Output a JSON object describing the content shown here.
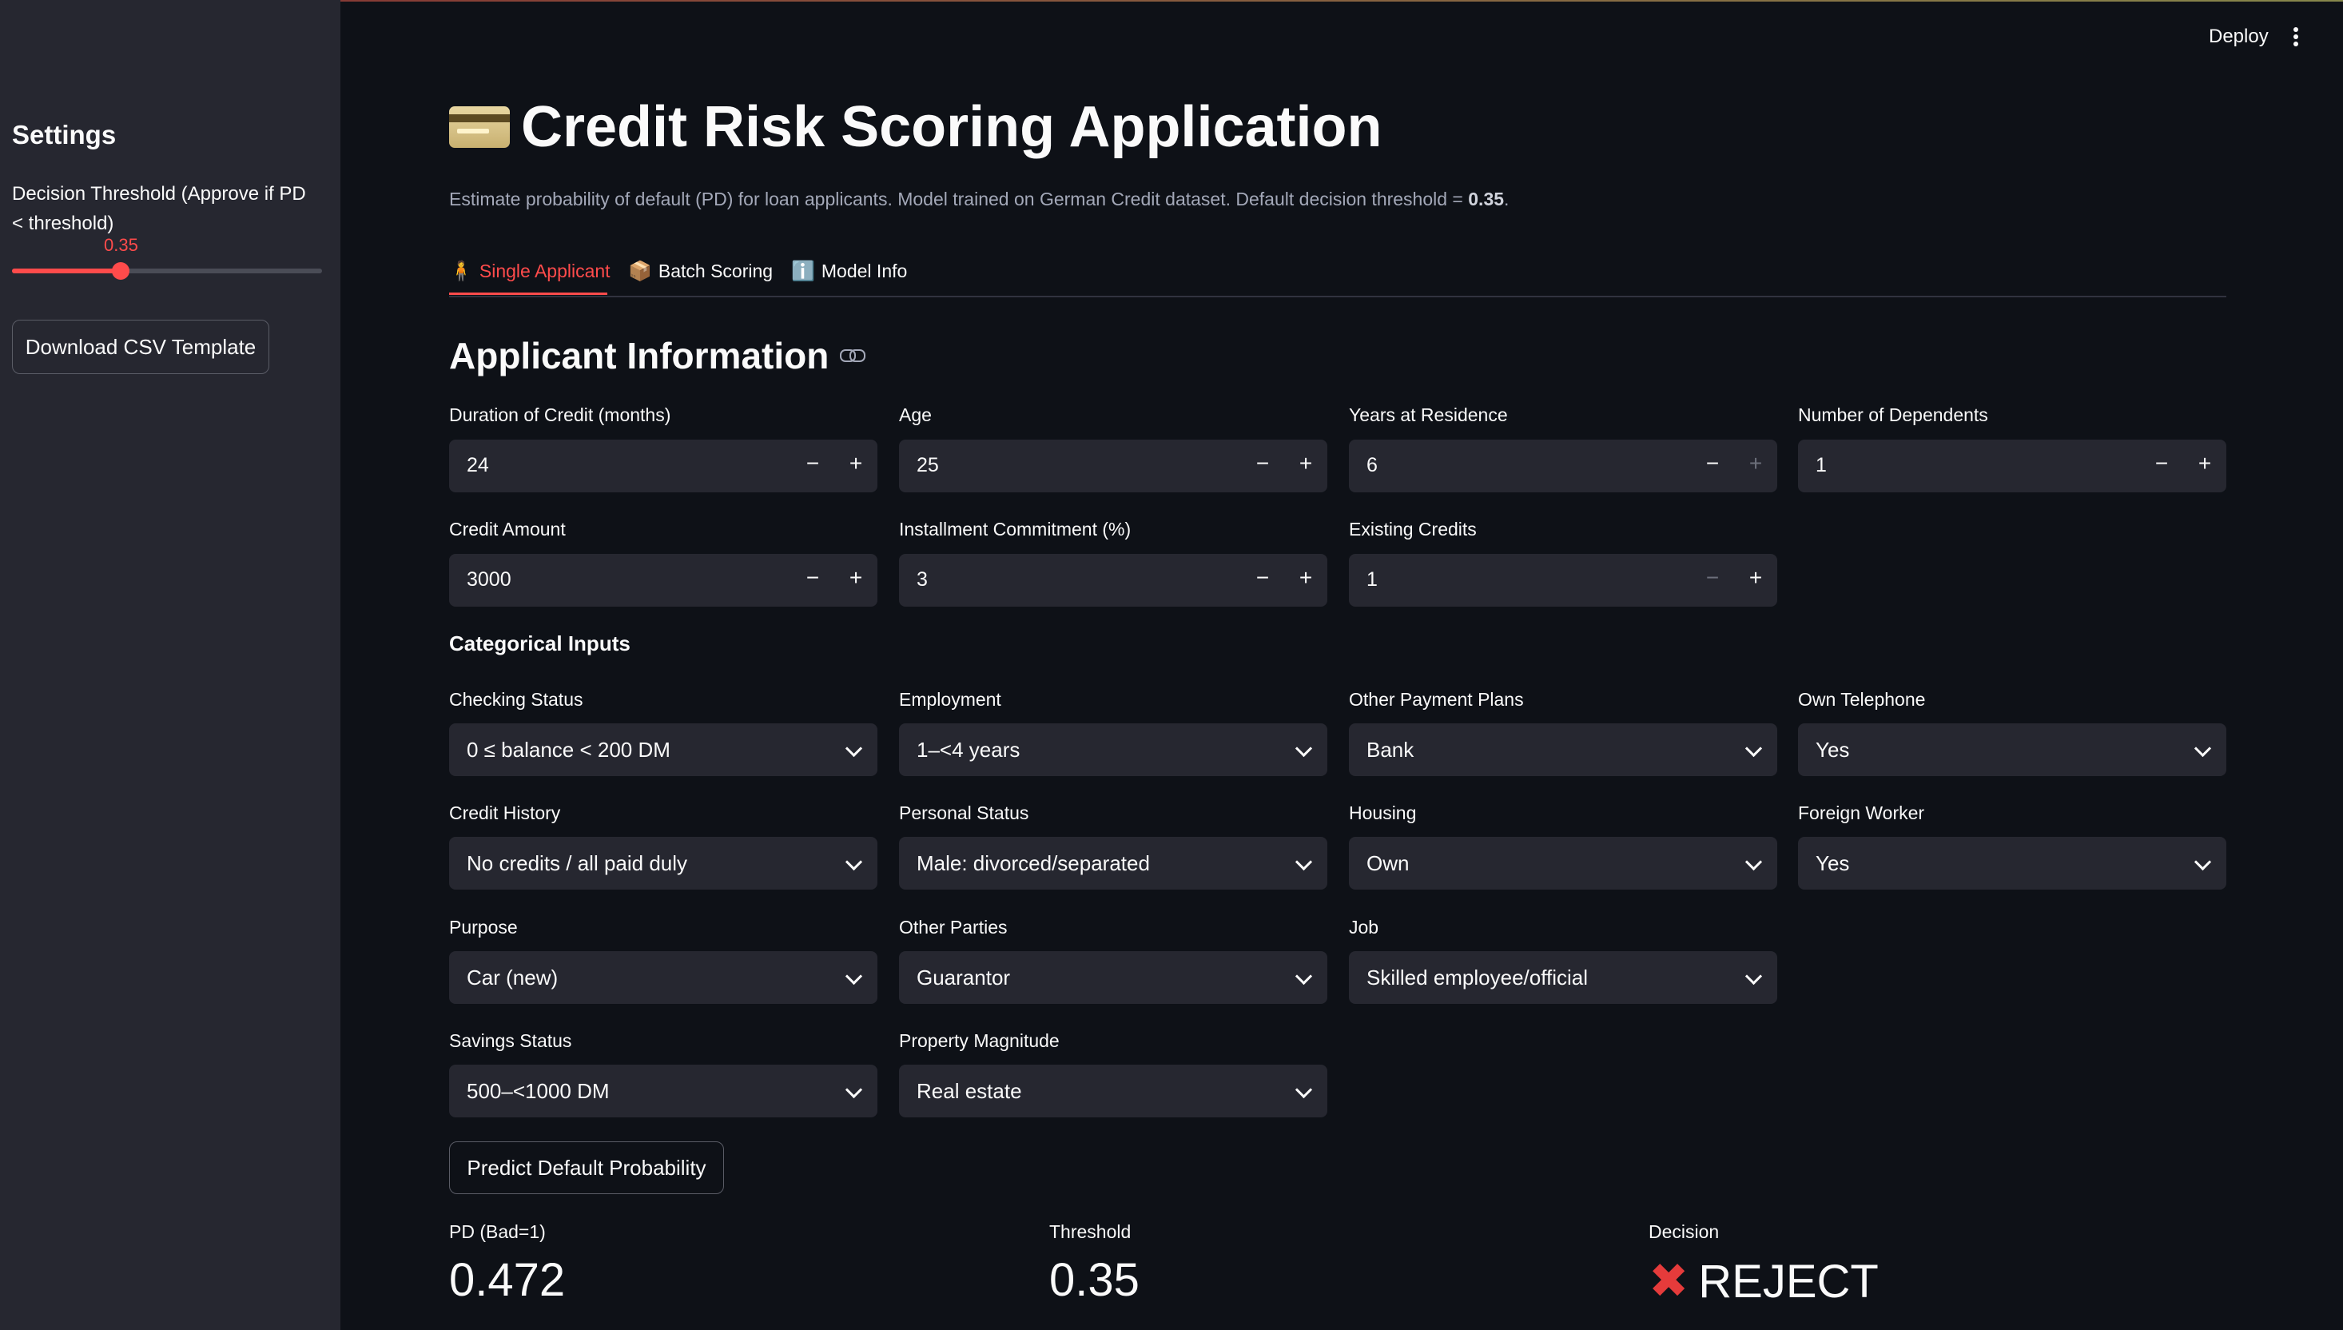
{
  "app": {
    "deploy_label": "Deploy",
    "title": "Credit Risk Scoring Application",
    "subtitle_prefix": "Estimate probability of default (PD) for loan applicants. Model trained on German Credit dataset. Default decision threshold = ",
    "subtitle_threshold": "0.35",
    "subtitle_suffix": "."
  },
  "sidebar": {
    "title": "Settings",
    "threshold_label": "Decision Threshold (Approve if PD < threshold)",
    "threshold_value": "0.35",
    "threshold_fraction": 0.35,
    "download_button": "Download CSV Template"
  },
  "tabs": [
    {
      "icon": "🧍",
      "label": "Single Applicant",
      "active": true
    },
    {
      "icon": "📦",
      "label": "Batch Scoring",
      "active": false
    },
    {
      "icon": "ℹ️",
      "label": "Model Info",
      "active": false
    }
  ],
  "applicant": {
    "section_title": "Applicant Information",
    "numeric": [
      {
        "label": "Duration of Credit (months)",
        "value": "24"
      },
      {
        "label": "Age",
        "value": "25"
      },
      {
        "label": "Years at Residence",
        "value": "6"
      },
      {
        "label": "Number of Dependents",
        "value": "1"
      },
      {
        "label": "Credit Amount",
        "value": "3000"
      },
      {
        "label": "Installment Commitment (%)",
        "value": "3"
      },
      {
        "label": "Existing Credits",
        "value": "1"
      }
    ],
    "categorical_title": "Categorical Inputs",
    "categorical": [
      {
        "label": "Checking Status",
        "value": "0 ≤ balance < 200 DM"
      },
      {
        "label": "Employment",
        "value": "1–<4 years"
      },
      {
        "label": "Other Payment Plans",
        "value": "Bank"
      },
      {
        "label": "Own Telephone",
        "value": "Yes"
      },
      {
        "label": "Credit History",
        "value": "No credits / all paid duly"
      },
      {
        "label": "Personal Status",
        "value": "Male: divorced/separated"
      },
      {
        "label": "Housing",
        "value": "Own"
      },
      {
        "label": "Foreign Worker",
        "value": "Yes"
      },
      {
        "label": "Purpose",
        "value": "Car (new)"
      },
      {
        "label": "Other Parties",
        "value": "Guarantor"
      },
      {
        "label": "Job",
        "value": "Skilled employee/official"
      },
      {
        "label": "Savings Status",
        "value": "500–<1000 DM"
      },
      {
        "label": "Property Magnitude",
        "value": "Real estate"
      }
    ],
    "predict_button": "Predict Default Probability"
  },
  "results": {
    "pd_label": "PD (Bad=1)",
    "pd_value": "0.472",
    "threshold_label": "Threshold",
    "threshold_value": "0.35",
    "decision_label": "Decision",
    "decision_value": "REJECT"
  },
  "colors": {
    "accent": "#ff4b4b",
    "background": "#0e1117",
    "sidebar": "#262730",
    "reject": "#e53b3b"
  }
}
